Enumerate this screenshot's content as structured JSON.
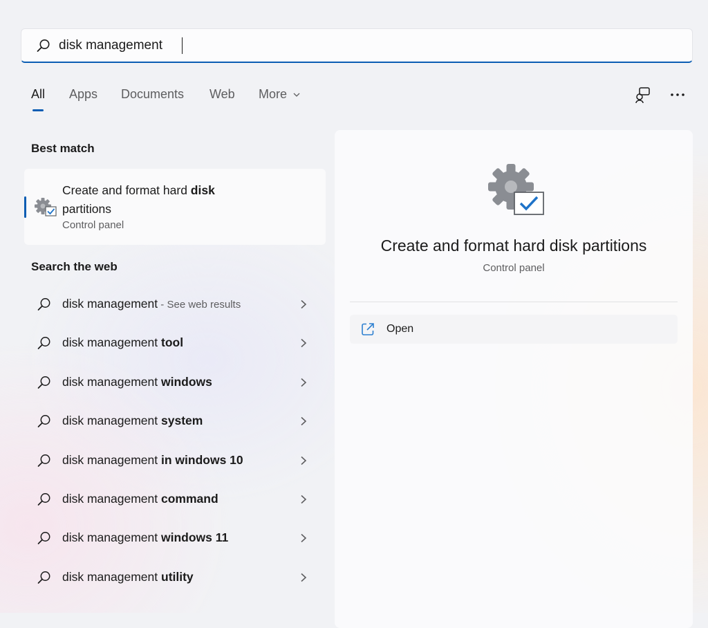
{
  "search": {
    "value": "disk management"
  },
  "tabs": [
    {
      "label": "All",
      "active": true
    },
    {
      "label": "Apps"
    },
    {
      "label": "Documents"
    },
    {
      "label": "Web"
    },
    {
      "label": "More"
    }
  ],
  "toolbar_icons": [
    "connected-devices-icon",
    "more-options-icon"
  ],
  "best_match": {
    "section_label": "Best match",
    "title_start": "Create and format hard ",
    "title_bold": "disk",
    "title_end": "partitions",
    "subtitle": "Control panel",
    "icon": "gear-checkmark-icon"
  },
  "web": {
    "section_label": "Search the web",
    "items": [
      {
        "prefix": "disk management",
        "bold": "",
        "hint": " - See web results"
      },
      {
        "prefix": "disk management ",
        "bold": "tool",
        "hint": ""
      },
      {
        "prefix": "disk management ",
        "bold": "windows",
        "hint": ""
      },
      {
        "prefix": "disk management ",
        "bold": "system",
        "hint": ""
      },
      {
        "prefix": "disk management ",
        "bold": "in windows 10",
        "hint": ""
      },
      {
        "prefix": "disk management ",
        "bold": "command",
        "hint": ""
      },
      {
        "prefix": "disk management ",
        "bold": "windows 11",
        "hint": ""
      },
      {
        "prefix": "disk management ",
        "bold": "utility",
        "hint": ""
      }
    ]
  },
  "preview": {
    "title": "Create and format hard disk partitions",
    "subtitle": "Control panel",
    "actions": [
      {
        "label": "Open",
        "icon": "open-external-icon"
      }
    ]
  },
  "colors": {
    "accent": "#0a5db3",
    "link_icon": "#2c7fd0"
  }
}
